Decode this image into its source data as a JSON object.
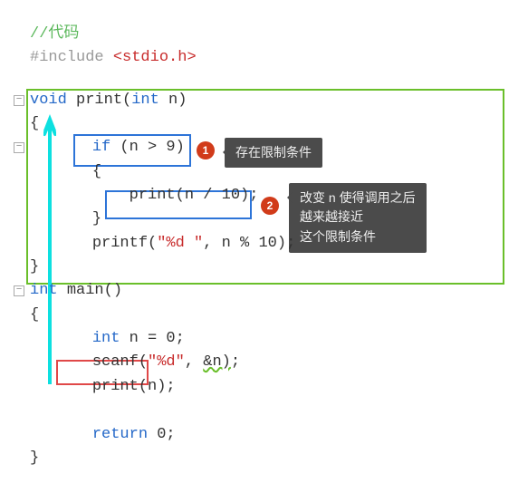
{
  "header": {
    "comment": "//代码",
    "include_kw": "#include ",
    "include_open": "<",
    "include_name": "stdio.h",
    "include_close": ">"
  },
  "code": {
    "l1_type": "void ",
    "l1_name": "print",
    "l1_args_open": "(",
    "l1_args_type": "int ",
    "l1_args_name": "n",
    "l1_args_close": ")",
    "l2": "{",
    "l3_kw": "if ",
    "l3_cond": "(n > 9)",
    "l4": "{",
    "l5_call": "print(n / 10);",
    "l6": "}",
    "l7a": "printf(",
    "l7_str": "\"%d \"",
    "l7b": ", n % 10);",
    "l8": "}",
    "m1_type": "int ",
    "m1_name": "main()",
    "m2": "{",
    "m3_type": "int ",
    "m3_rest": "n = 0;",
    "m4a": "scanf(",
    "m4_str": "\"%d\"",
    "m4b": ", ",
    "m4c": "&n)",
    "m4d": ";",
    "m5": "print(n);",
    "m6": "return 0;",
    "m7": "}"
  },
  "ann": {
    "badge1": "1",
    "badge2": "2",
    "tip1": "存在限制条件",
    "tip2_l1": "改变 n 使得调用之后",
    "tip2_l2": "越来越接近",
    "tip2_l3": "这个限制条件"
  },
  "fold": {
    "minus": "−"
  }
}
